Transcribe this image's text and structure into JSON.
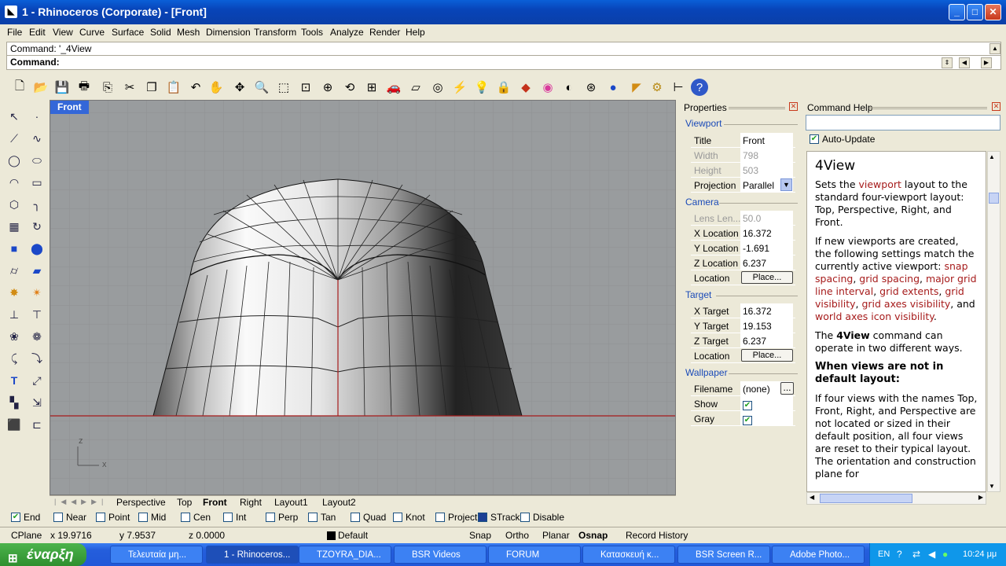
{
  "window": {
    "title": "1 - Rhinoceros (Corporate) - [Front]",
    "controls": {
      "minimize": "_",
      "maximize": "□",
      "close": "✕"
    }
  },
  "menu": [
    "File",
    "Edit",
    "View",
    "Curve",
    "Surface",
    "Solid",
    "Mesh",
    "Dimension",
    "Transform",
    "Tools",
    "Analyze",
    "Render",
    "Help"
  ],
  "command": {
    "history": "Command: '_4View",
    "prompt": "Command:"
  },
  "viewport": {
    "title": "Front",
    "axis_z": "z",
    "axis_x": "x"
  },
  "viewport_tabs": [
    "Perspective",
    "Top",
    "Front",
    "Right",
    "Layout1",
    "Layout2"
  ],
  "properties": {
    "title": "Properties",
    "viewport_section": "Viewport",
    "title_label": "Title",
    "title_value": "Front",
    "width_label": "Width",
    "width_value": "798",
    "height_label": "Height",
    "height_value": "503",
    "projection_label": "Projection",
    "projection_value": "Parallel",
    "camera_section": "Camera",
    "lens_label": "Lens Len...",
    "lens_value": "50.0",
    "xloc_label": "X Location",
    "xloc_value": "16.372",
    "yloc_label": "Y Location",
    "yloc_value": "-1.691",
    "zloc_label": "Z Location",
    "zloc_value": "6.237",
    "location_label": "Location",
    "place_button": "Place...",
    "target_section": "Target",
    "xt_label": "X Target",
    "xt_value": "16.372",
    "yt_label": "Y Target",
    "yt_value": "19.153",
    "zt_label": "Z Target",
    "zt_value": "6.237",
    "tlocation_label": "Location",
    "tplace_button": "Place...",
    "wallpaper_section": "Wallpaper",
    "filename_label": "Filename",
    "filename_value": "(none)",
    "browse_button": "...",
    "show_label": "Show",
    "gray_label": "Gray"
  },
  "help": {
    "title": "Command Help",
    "auto_update": "Auto-Update",
    "heading": "4View",
    "p1a": "Sets the ",
    "p1link": "viewport",
    "p1b": " layout to the standard four-viewport layout: Top, Perspective, Right, and Front.",
    "p2a": "If new viewports are created, the following settings match the currently active viewport: ",
    "l1": "snap spacing",
    "l2": "grid spacing",
    "l3": "major grid line interval",
    "l4": "grid extents",
    "l5": "grid visibility",
    "l6": "grid axes visibility",
    "and": ", and ",
    "l7": "world axes icon visibility",
    "dot": ".",
    "p3a": "The ",
    "p3b": "4View",
    "p3c": " command can operate in two different ways.",
    "h2": "When views are not in default layout:",
    "p4": "If four views with the names Top, Front, Right, and Perspective are not located or sized in their default position, all four views are reset to their typical layout. The orientation and construction plane for"
  },
  "osnap": [
    {
      "label": "End",
      "checked": true
    },
    {
      "label": "Near"
    },
    {
      "label": "Point"
    },
    {
      "label": "Mid"
    },
    {
      "label": "Cen"
    },
    {
      "label": "Int"
    },
    {
      "label": "Perp"
    },
    {
      "label": "Tan"
    },
    {
      "label": "Quad"
    },
    {
      "label": "Knot"
    },
    {
      "label": "Project"
    },
    {
      "label": "STrack"
    },
    {
      "label": "Disable"
    }
  ],
  "status": {
    "cplane": "CPlane",
    "x": "x 19.9716",
    "y": "y 7.9537",
    "z": "z 0.0000",
    "layer": "Default",
    "snap": "Snap",
    "ortho": "Ortho",
    "planar": "Planar",
    "osnap": "Osnap",
    "record": "Record History"
  },
  "taskbar": {
    "start": "έναρξη",
    "tasks": [
      "Τελευταία μη...",
      "1 - Rhinoceros...",
      "TZOYRA_DIA...",
      "BSR Videos",
      "FORUM",
      "Κατασκευή κ...",
      "BSR Screen R...",
      "Adobe Photo..."
    ],
    "lang": "EN",
    "time": "10:24 μμ"
  }
}
